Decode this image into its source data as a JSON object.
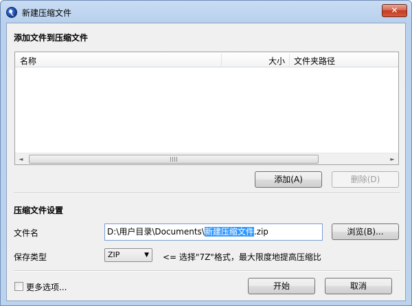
{
  "window": {
    "title": "新建压缩文件",
    "close_label": "✕"
  },
  "add_section": {
    "title": "添加文件到压缩文件",
    "columns": [
      "名称",
      "大小",
      "文件夹路径"
    ],
    "scroll_left": "◄",
    "scroll_right": "►",
    "add_label": "添加(A)",
    "delete_label": "删除(D)"
  },
  "settings": {
    "title": "压缩文件设置",
    "filename_label": "文件名",
    "filename_prefix": "D:\\用户目录\\Documents\\",
    "filename_selected": "新建压缩文件",
    "filename_suffix": ".zip",
    "browse_label": "浏览(B)...",
    "type_label": "保存类型",
    "type_value": "ZIP",
    "type_arrow": "▼",
    "type_hint": "<= 选择\"7Z\"格式，最大限度地提高压缩比"
  },
  "footer": {
    "more_options_label": "更多选项...",
    "start_label": "开始",
    "cancel_label": "取消"
  }
}
